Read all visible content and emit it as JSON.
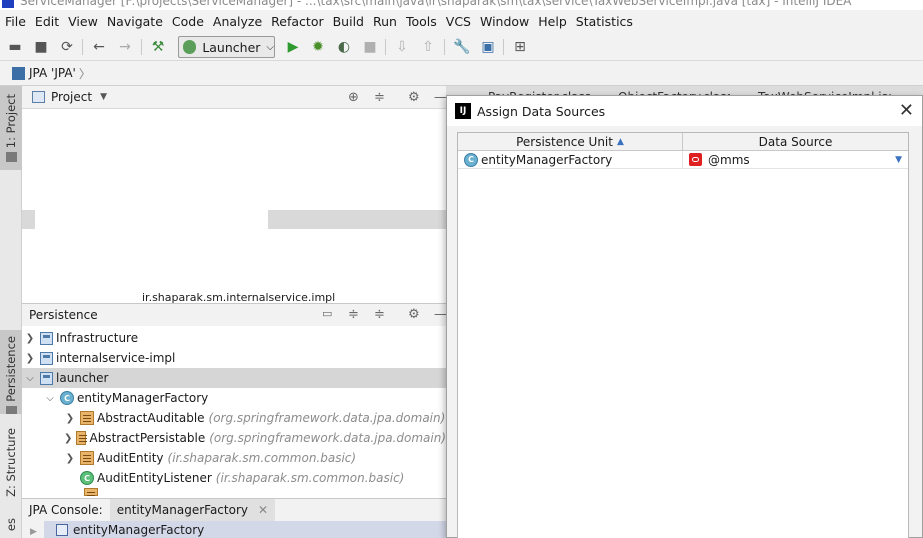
{
  "window": {
    "title": "ServiceManager [F:\\projects\\ServiceManager] - ...\\tax\\src\\main\\java\\ir\\shaparak\\sm\\tax\\service\\TaxWebServiceImpl.java [tax] - IntelliJ IDEA"
  },
  "menu": [
    "File",
    "Edit",
    "View",
    "Navigate",
    "Code",
    "Analyze",
    "Refactor",
    "Build",
    "Run",
    "Tools",
    "VCS",
    "Window",
    "Help",
    "Statistics"
  ],
  "toolbar": {
    "run_config": "Launcher"
  },
  "navbar": {
    "crumb": "JPA 'JPA'"
  },
  "left_tabs": {
    "project": "1: Project",
    "persistence": "Persistence",
    "structure": "Z: Structure",
    "favorites": "es"
  },
  "project_panel": {
    "title": "Project",
    "hidden_row": "ir.shaparak.sm.internalservice.impl"
  },
  "persistence_panel": {
    "title": "Persistence",
    "rows": [
      {
        "label": "Infrastructure",
        "pkg": ""
      },
      {
        "label": "internalservice-impl",
        "pkg": ""
      },
      {
        "label": "launcher",
        "pkg": ""
      },
      {
        "label": "entityManagerFactory",
        "pkg": ""
      },
      {
        "label": "AbstractAuditable",
        "pkg": "(org.springframework.data.jpa.domain)"
      },
      {
        "label": "AbstractPersistable",
        "pkg": "(org.springframework.data.jpa.domain)"
      },
      {
        "label": "AuditEntity",
        "pkg": "(ir.shaparak.sm.common.basic)"
      },
      {
        "label": "AuditEntityListener",
        "pkg": "(ir.shaparak.sm.common.basic)"
      }
    ]
  },
  "console": {
    "label": "JPA Console:",
    "tab": "entityManagerFactory",
    "row": "entityManagerFactory"
  },
  "editor_tabs": [
    "PayRegister.class",
    "ObjectFactory.class",
    "TaxWebServiceImpl.java"
  ],
  "dialog": {
    "title": "Assign Data Sources",
    "col_unit": "Persistence Unit",
    "col_ds": "Data Source",
    "row": {
      "unit": "entityManagerFactory",
      "ds": "@mms"
    }
  }
}
